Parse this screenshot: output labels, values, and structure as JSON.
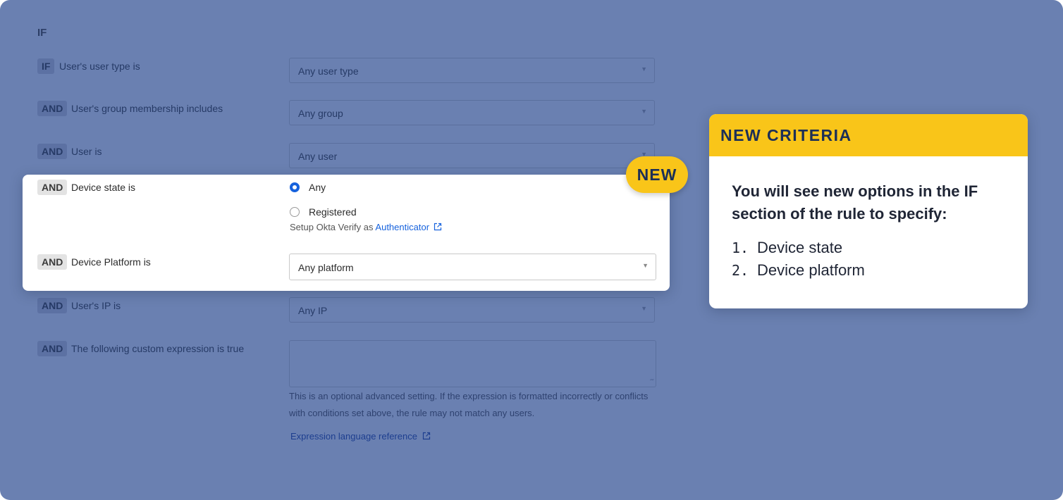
{
  "section_title": "IF",
  "rows": {
    "user_type": {
      "connector": "IF",
      "label": "User's user type is",
      "value": "Any user type"
    },
    "group": {
      "connector": "AND",
      "label": "User's group membership includes",
      "value": "Any group"
    },
    "user": {
      "connector": "AND",
      "label": "User is",
      "value": "Any user"
    },
    "device_state": {
      "connector": "AND",
      "label": "Device state is",
      "options": [
        {
          "label": "Any",
          "selected": true
        },
        {
          "label": "Registered",
          "selected": false
        }
      ],
      "setup_text": "Setup Okta Verify as",
      "setup_link": "Authenticator"
    },
    "device_platform": {
      "connector": "AND",
      "label": "Device Platform is",
      "value": "Any platform"
    },
    "ip": {
      "connector": "AND",
      "label": "User's IP is",
      "value": "Any IP"
    },
    "custom_expression": {
      "connector": "AND",
      "label": "The following custom expression is true",
      "value": "",
      "helper": "This is an optional advanced setting. If the expression is formatted incorrectly or conflicts with conditions set above, the rule may not match any users.",
      "link": "Expression language reference"
    }
  },
  "new_badge": "NEW",
  "callout": {
    "title": "NEW CRITERIA",
    "body": "You will see new options in the IF section of the rule to specify:",
    "items": [
      {
        "num": "1.",
        "text": "Device state"
      },
      {
        "num": "2.",
        "text": "Device platform"
      }
    ]
  },
  "colors": {
    "overlay": "#6a80b1",
    "accent_yellow": "#f9c519",
    "link_blue": "#1662dd",
    "navy": "#1c2f57"
  },
  "icons": {
    "caret": "caret-down-icon",
    "external": "external-link-icon"
  }
}
